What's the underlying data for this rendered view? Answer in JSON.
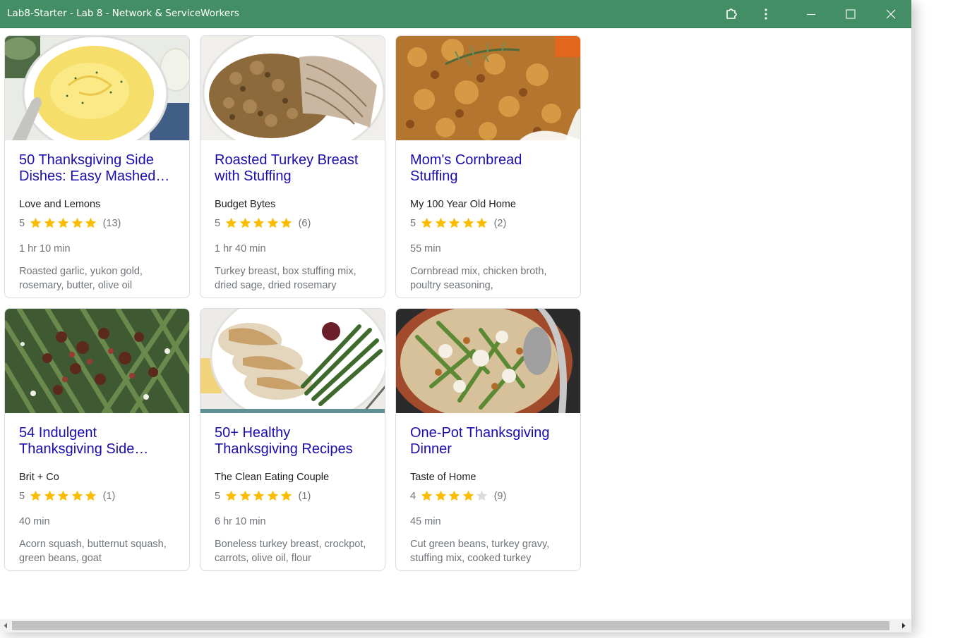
{
  "window": {
    "title": "Lab8-Starter - Lab 8 - Network & ServiceWorkers"
  },
  "titlebar_icons": [
    "extensions-icon",
    "more-vert-icon",
    "minimize-icon",
    "maximize-icon",
    "close-icon"
  ],
  "colors": {
    "titlebar": "#448e66",
    "link": "#1a0dab",
    "star": "#fbbc04",
    "star_empty": "#dadce0"
  },
  "recipes": [
    {
      "title": "50 Thanksgiving Side Dishes: Easy Mashed…",
      "org": "Love and Lemons",
      "rating": "5",
      "stars": 5,
      "reviews": "(13)",
      "time": "1 hr 10 min",
      "ingredients": "Roasted garlic, yukon gold, rosemary, butter, olive oil"
    },
    {
      "title": "Roasted Turkey Breast with Stuffing",
      "org": "Budget Bytes",
      "rating": "5",
      "stars": 5,
      "reviews": "(6)",
      "time": "1 hr 40 min",
      "ingredients": "Turkey breast, box stuffing mix, dried sage, dried rosemary"
    },
    {
      "title": "Mom's Cornbread Stuffing",
      "org": "My 100 Year Old Home",
      "rating": "5",
      "stars": 5,
      "reviews": "(2)",
      "time": "55 min",
      "ingredients": "Cornbread mix, chicken broth, poultry seasoning,"
    },
    {
      "title": "54 Indulgent Thanksgiving Side…",
      "org": "Brit + Co",
      "rating": "5",
      "stars": 5,
      "reviews": "(1)",
      "time": "40 min",
      "ingredients": "Acorn squash, butternut squash, green beans, goat"
    },
    {
      "title": "50+ Healthy Thanksgiving Recipes",
      "org": "The Clean Eating Couple",
      "rating": "5",
      "stars": 5,
      "reviews": "(1)",
      "time": "6 hr 10 min",
      "ingredients": "Boneless turkey breast, crockpot, carrots, olive oil, flour"
    },
    {
      "title": "One-Pot Thanksgiving Dinner",
      "org": "Taste of Home",
      "rating": "4",
      "stars": 4,
      "reviews": "(9)",
      "time": "45 min",
      "ingredients": "Cut green beans, turkey gravy, stuffing mix, cooked turkey"
    }
  ]
}
